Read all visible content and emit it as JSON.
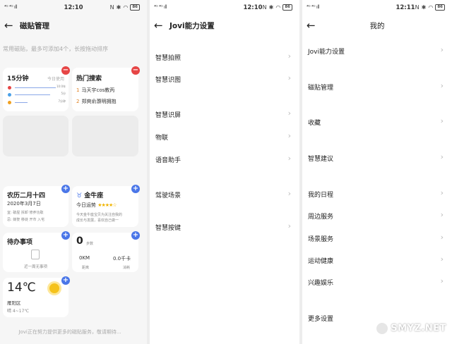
{
  "status": {
    "carrier": "⁴ᴳ ⁴ᴳ ıll",
    "battery": "86",
    "p1_time": "12:10",
    "p2_time": "12:10",
    "p3_time": "12:11"
  },
  "panel1": {
    "title": "磁贴管理",
    "hint": "常用磁贴，最多可添加4个，长按拖动排序",
    "timer": {
      "title": "15分钟",
      "sub": "今日使用",
      "rows": [
        "10:0年",
        "5分",
        "7分钟"
      ]
    },
    "hot": {
      "title": "热门搜索",
      "items": [
        {
          "num": "1",
          "text": "马天宇cos教丙"
        },
        {
          "num": "2",
          "text": "郑爽俞灏明拥抱"
        }
      ]
    },
    "calendar": {
      "title": "农历二月十四",
      "date": "2020年3月7日",
      "line1": "宜: 破屋 拆卸 修养功取",
      "line2": "忌: 嫁娶 移徙 开市 入宅"
    },
    "horoscope": {
      "title": "金牛座",
      "fortune": "今日运势",
      "stars": "★★★★☆",
      "desc1": "今天金牛座宝贝为关注自我的",
      "desc2": "成长与发展，喜欢自己做一"
    },
    "todo": {
      "title": "待办事项",
      "empty": "近一周无事项"
    },
    "steps": {
      "count": "0",
      "unit": "步数",
      "distance": "0KM",
      "distance_label": "距离",
      "calories": "0.0千卡",
      "calories_label": "消耗"
    },
    "weather": {
      "temp": "14℃",
      "district": "雁阳区",
      "range": "晴 4~17℃"
    },
    "footer": "Jovi正在努力提供更多的磁贴服务，敬请期待..."
  },
  "panel2": {
    "title": "Jovi能力设置",
    "items": [
      "智慧拍照",
      "智慧识图",
      "智慧识屏",
      "物联",
      "语音助手",
      "驾驶场景",
      "智慧按键"
    ]
  },
  "panel3": {
    "title": "我的",
    "items": [
      "Jovi能力设置",
      "磁贴管理",
      "收藏",
      "智慧建议",
      "我的日程",
      "周边服务",
      "场景服务",
      "运动健康",
      "兴趣娱乐",
      "更多设置"
    ]
  },
  "watermark": "SMYZ.NET",
  "icons": {
    "back": "arrow-left-icon",
    "chevron": "chevron-right-icon",
    "remove": "minus-circle-icon",
    "add": "plus-circle-icon"
  },
  "colors": {
    "remove": "#e64545",
    "add": "#4a76e8",
    "accent_num": "#e08020"
  }
}
